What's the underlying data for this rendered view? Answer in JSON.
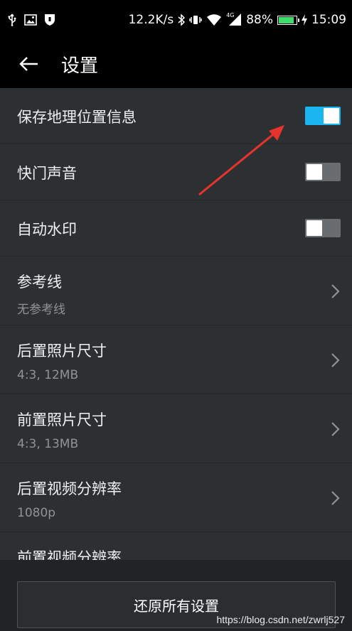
{
  "status_bar": {
    "net_speed": "12.2K/s",
    "network_type": "4G",
    "battery_percent": "88%",
    "battery_level": 0.88,
    "time": "15:09",
    "icons": [
      "usb-icon",
      "image-icon",
      "shield-icon",
      "bluetooth-icon",
      "vibrate-icon",
      "wifi-icon",
      "signal-icon",
      "charging-icon"
    ]
  },
  "header": {
    "title": "设置"
  },
  "settings": {
    "items": [
      {
        "title": "保存地理位置信息",
        "type": "toggle",
        "on": true
      },
      {
        "title": "快门声音",
        "type": "toggle",
        "on": false
      },
      {
        "title": "自动水印",
        "type": "toggle",
        "on": false
      },
      {
        "title": "参考线",
        "subtitle": "无参考线",
        "type": "nav"
      },
      {
        "title": "后置照片尺寸",
        "subtitle": "4:3, 12MB",
        "type": "nav"
      },
      {
        "title": "前置照片尺寸",
        "subtitle": "4:3, 13MB",
        "type": "nav"
      },
      {
        "title": "后置视频分辨率",
        "subtitle": "1080p",
        "type": "nav"
      },
      {
        "title": "前置视频分辨率",
        "type": "nav"
      }
    ]
  },
  "footer": {
    "reset_label": "还原所有设置",
    "watermark": "https://blog.csdn.net/zwrlj527"
  },
  "colors": {
    "toggle_on": "#19b6f2",
    "toggle_off": "#6a6d70",
    "annotation": "#e8322e",
    "background": "#2d3033"
  }
}
